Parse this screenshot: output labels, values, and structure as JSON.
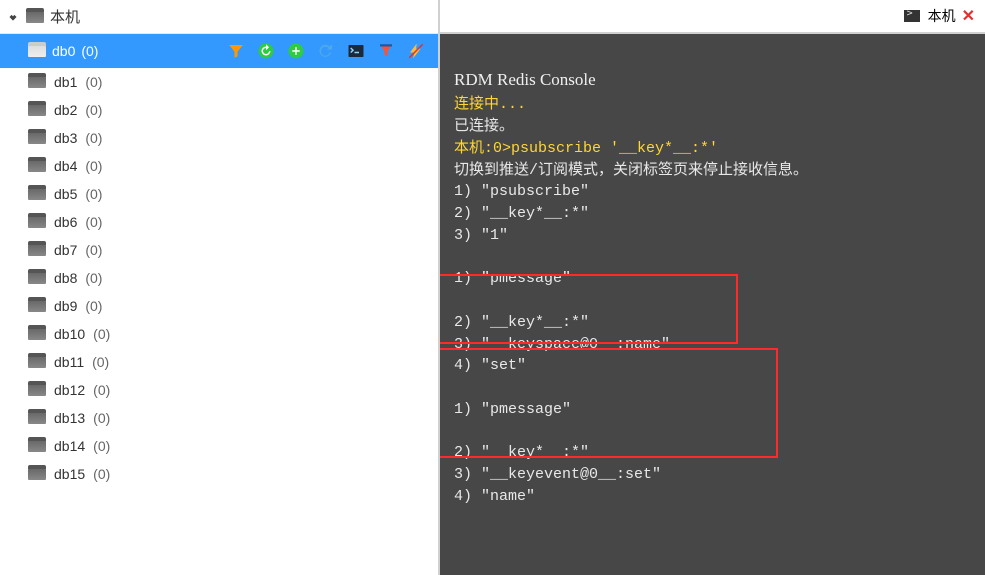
{
  "connection": {
    "name": "本机"
  },
  "selected_db": {
    "name": "db0",
    "count": "(0)"
  },
  "dbs": [
    {
      "name": "db1",
      "count": "(0)"
    },
    {
      "name": "db2",
      "count": "(0)"
    },
    {
      "name": "db3",
      "count": "(0)"
    },
    {
      "name": "db4",
      "count": "(0)"
    },
    {
      "name": "db5",
      "count": "(0)"
    },
    {
      "name": "db6",
      "count": "(0)"
    },
    {
      "name": "db7",
      "count": "(0)"
    },
    {
      "name": "db8",
      "count": "(0)"
    },
    {
      "name": "db9",
      "count": "(0)"
    },
    {
      "name": "db10",
      "count": "(0)"
    },
    {
      "name": "db11",
      "count": "(0)"
    },
    {
      "name": "db12",
      "count": "(0)"
    },
    {
      "name": "db13",
      "count": "(0)"
    },
    {
      "name": "db14",
      "count": "(0)"
    },
    {
      "name": "db15",
      "count": "(0)"
    }
  ],
  "tab": {
    "label": "本机"
  },
  "console": {
    "title": "RDM Redis Console",
    "connecting": "连接中...",
    "connected": "已连接。",
    "prompt": "本机:0>psubscribe '__key*__:*'",
    "switch_msg": "切换到推送/订阅模式，关闭标签页来停止接收信息。",
    "lines1": [
      "1) \"psubscribe\"",
      "2) \"__key*__:*\"",
      "3) \"1\""
    ],
    "block_pmessage_a": "1) \"pmessage\"",
    "block_a": [
      "2) \"__key*__:*\"",
      "3) \"__keyspace@0__:name\"",
      "4) \"set\""
    ],
    "block_b_head": "1) \"pmessage\"",
    "block_b": [
      "2) \"__key*__:*\"",
      "3) \"__keyevent@0__:set\"",
      "4) \"name\""
    ]
  }
}
